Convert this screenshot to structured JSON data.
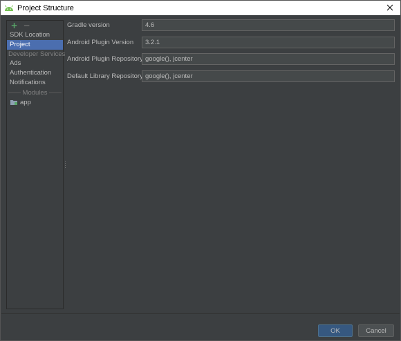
{
  "window": {
    "title": "Project Structure"
  },
  "toolbar": {
    "add_icon": "+",
    "remove_icon": "−"
  },
  "sidebar": {
    "items": [
      {
        "label": "SDK Location"
      },
      {
        "label": "Project",
        "selected": true
      }
    ],
    "developer_services_header": "Developer Services",
    "services": [
      {
        "label": "Ads"
      },
      {
        "label": "Authentication"
      },
      {
        "label": "Notifications"
      }
    ],
    "modules_header": "Modules",
    "modules": [
      {
        "label": "app"
      }
    ]
  },
  "form": {
    "gradle_version": {
      "label": "Gradle version",
      "value": "4.6"
    },
    "plugin_version": {
      "label": "Android Plugin Version",
      "value": "3.2.1"
    },
    "plugin_repository": {
      "label": "Android Plugin Repository",
      "value": "google(), jcenter"
    },
    "library_repository": {
      "label": "Default Library Repository",
      "value": "google(), jcenter"
    }
  },
  "buttons": {
    "ok_label": "OK",
    "cancel_label": "Cancel"
  },
  "colors": {
    "background": "#3c3f41",
    "selection": "#4b6eaf",
    "add_icon": "#59a869",
    "ok_button": "#365880",
    "titlebar": "#ffffff"
  }
}
